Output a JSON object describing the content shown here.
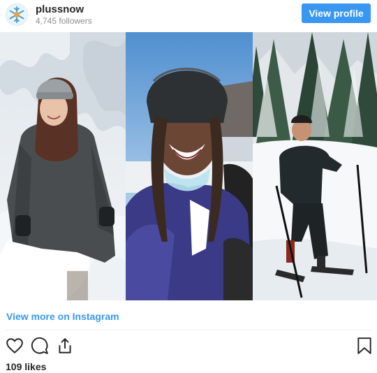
{
  "header": {
    "username": "plussnow",
    "followers": "4,745 followers",
    "view_profile_label": "View profile"
  },
  "post": {
    "photos": [
      "snow-portrait-long-hair",
      "smiling-helmet-selfie",
      "snowshoe-hiker"
    ],
    "view_more_label": "View more on Instagram",
    "likes": "109 likes"
  },
  "icons": {
    "avatar": "snowflake-icon",
    "like": "heart-icon",
    "comment": "comment-icon",
    "share": "share-icon",
    "save": "bookmark-icon"
  },
  "colors": {
    "accent": "#3897f0",
    "text": "#262626",
    "muted": "#8e8e8e"
  }
}
